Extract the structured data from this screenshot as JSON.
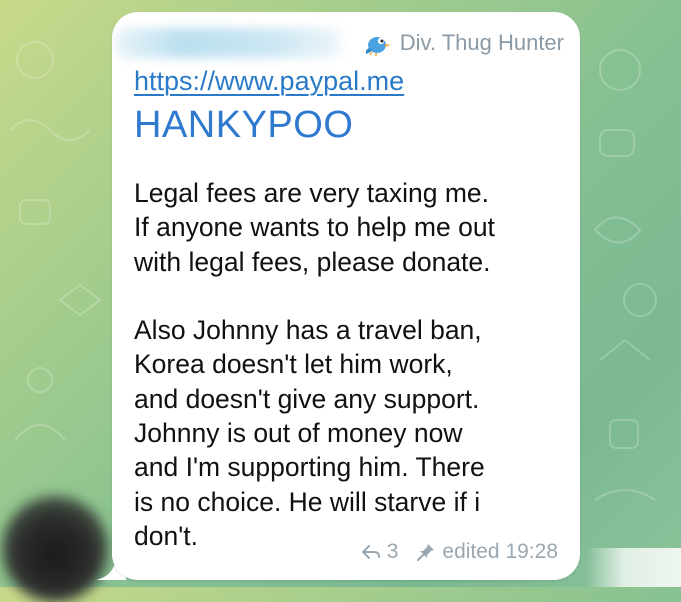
{
  "colors": {
    "bubble_bg": "#ffffff",
    "link": "#2a7ac8",
    "handle": "#2f79cf",
    "text": "#111111",
    "meta": "#9aa7b0"
  },
  "message": {
    "signature_icon": "bird-emoji-icon",
    "signature": "Div. Thug Hunter",
    "link": "https://www.paypal.me",
    "handle": "HANKYPOO",
    "paragraph_1": "Legal fees are very taxing me.\nIf anyone wants to help me out\nwith legal fees,  please donate.",
    "paragraph_2": "Also Johnny has a travel ban,\nKorea doesn't let him work,\nand doesn't give any support.\nJohnny is out of money now\nand I'm supporting him. There\nis no choice. He will starve if i\ndon't.",
    "reply_icon": "reply-arrow-icon",
    "reply_count": "3",
    "pin_icon": "pin-icon",
    "edited_time": "edited 19:28"
  }
}
